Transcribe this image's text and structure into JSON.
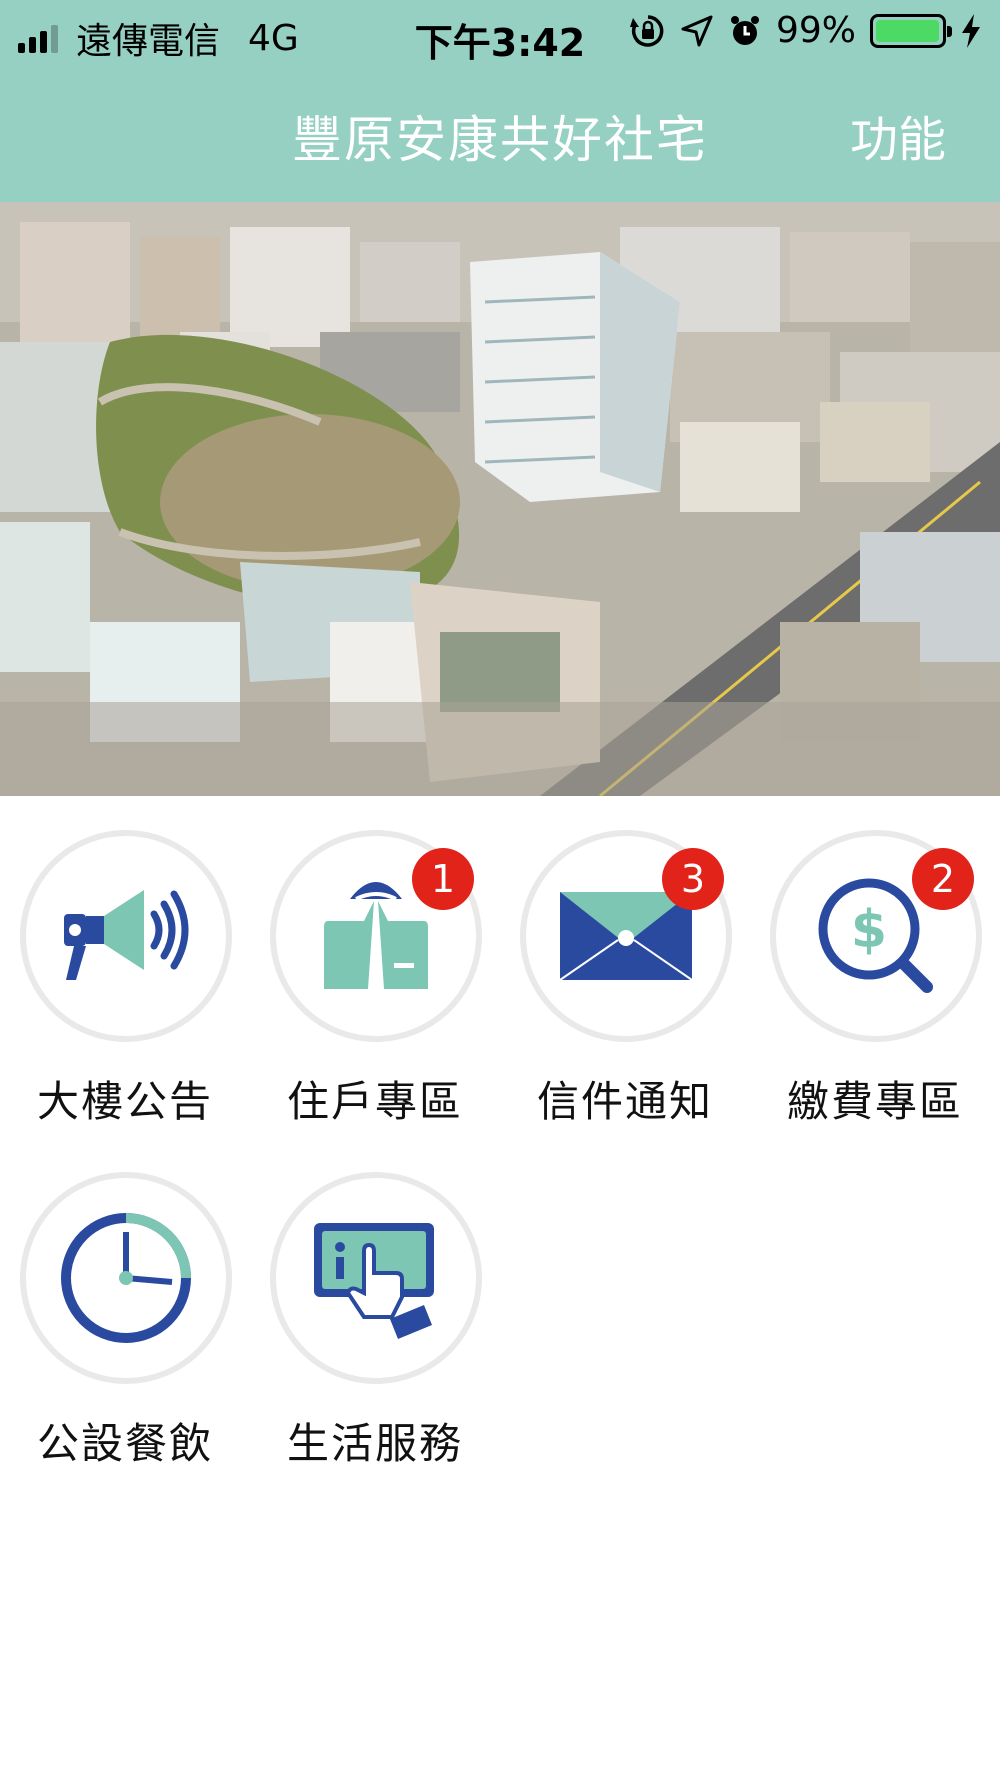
{
  "status_bar": {
    "carrier": "遠傳電信",
    "network": "4G",
    "time": "下午3:42",
    "battery_percent_text": "99%",
    "battery_level": 0.99,
    "icons": [
      "signal-icon",
      "rotation-lock-icon",
      "location-arrow-icon",
      "alarm-icon",
      "battery-icon",
      "charging-bolt-icon"
    ]
  },
  "header": {
    "title": "豐原安康共好社宅",
    "function_button": "功能"
  },
  "colors": {
    "header_bg": "#96d0c2",
    "teal": "#7cc6b3",
    "blue": "#2a4aa0",
    "badge": "#e2231a"
  },
  "menu": [
    {
      "label": "大樓公告",
      "icon": "megaphone-icon",
      "badge": ""
    },
    {
      "label": "住戶專區",
      "icon": "resident-icon",
      "badge": "1"
    },
    {
      "label": "信件通知",
      "icon": "envelope-icon",
      "badge": "3"
    },
    {
      "label": "繳費專區",
      "icon": "payment-search-icon",
      "badge": "2"
    },
    {
      "label": "公設餐飲",
      "icon": "clock-icon",
      "badge": ""
    },
    {
      "label": "生活服務",
      "icon": "info-touch-icon",
      "badge": ""
    }
  ]
}
